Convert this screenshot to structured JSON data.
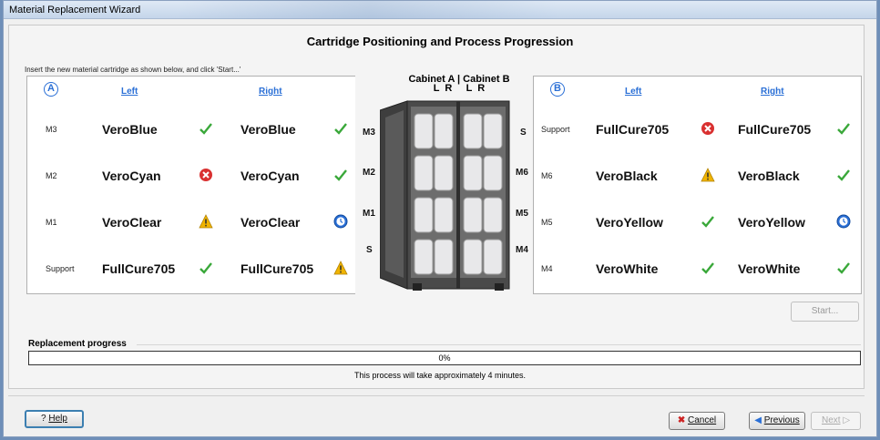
{
  "window": {
    "title": "Material Replacement Wizard"
  },
  "heading": "Cartridge Positioning and Process Progression",
  "instruction": "Insert the new material cartridge as shown below, and click 'Start...'",
  "cabinet_a": {
    "badge": "A",
    "col_left": "Left",
    "col_right": "Right",
    "rows": [
      {
        "slot": "M3",
        "left": "VeroBlue",
        "left_status": "ok",
        "right": "VeroBlue",
        "right_status": "ok"
      },
      {
        "slot": "M2",
        "left": "VeroCyan",
        "left_status": "error",
        "right": "VeroCyan",
        "right_status": "ok"
      },
      {
        "slot": "M1",
        "left": "VeroClear",
        "left_status": "warning",
        "right": "VeroClear",
        "right_status": "pending"
      },
      {
        "slot": "Support",
        "left": "FullCure705",
        "left_status": "ok",
        "right": "FullCure705",
        "right_status": "warning"
      }
    ]
  },
  "cabinet_b": {
    "badge": "B",
    "col_left": "Left",
    "col_right": "Right",
    "rows": [
      {
        "slot": "Support",
        "left": "FullCure705",
        "left_status": "error",
        "right": "FullCure705",
        "right_status": "ok"
      },
      {
        "slot": "M6",
        "left": "VeroBlack",
        "left_status": "warning",
        "right": "VeroBlack",
        "right_status": "ok"
      },
      {
        "slot": "M5",
        "left": "VeroYellow",
        "left_status": "ok",
        "right": "VeroYellow",
        "right_status": "pending"
      },
      {
        "slot": "M4",
        "left": "VeroWhite",
        "left_status": "ok",
        "right": "VeroWhite",
        "right_status": "ok"
      }
    ]
  },
  "cabinet_image": {
    "header_line1": "Cabinet A | Cabinet B",
    "header_line2": "L  R     L  R",
    "labels_left": [
      "M3",
      "M2",
      "M1",
      "S"
    ],
    "labels_mid": [
      "S",
      "M6",
      "M5",
      "M4"
    ]
  },
  "buttons": {
    "start": "Start...",
    "help": "Help",
    "cancel": "Cancel",
    "previous": "Previous",
    "next": "Next"
  },
  "progress": {
    "label": "Replacement progress",
    "percent_text": "0%",
    "value": 0,
    "note": "This process will take approximately 4 minutes."
  },
  "colors": {
    "ok": "#3aa83a",
    "error": "#d93030",
    "warning": "#f0b400",
    "pending": "#2a6fd6",
    "accent": "#2a6fd6"
  }
}
